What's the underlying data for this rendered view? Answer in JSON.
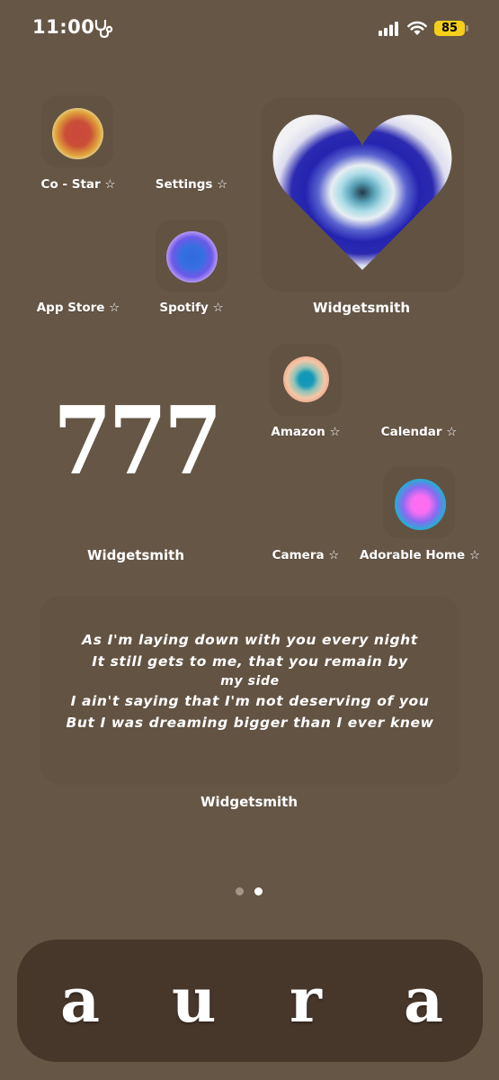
{
  "status_bar": {
    "time": "11:00",
    "focus_icon": "stethoscope-icon",
    "signal_icon": "cellular-signal-icon",
    "wifi_icon": "wifi-icon",
    "battery_level": "85",
    "battery_color": "#f5cf1a"
  },
  "apps": [
    {
      "label": "Co - Star ☆",
      "icon": "orb-red-yellow",
      "colors": [
        "#c9483a",
        "#e0a23a",
        "#eef0c0"
      ]
    },
    {
      "label": "Settings ☆",
      "icon": "blank"
    },
    {
      "label": "App Store ☆",
      "icon": "blank"
    },
    {
      "label": "Spotify ☆",
      "icon": "orb-blue-lilac",
      "colors": [
        "#2f6ae0",
        "#6c5ae8",
        "#f5d6fb"
      ]
    },
    {
      "label": "Amazon ☆",
      "icon": "orb-teal-peach",
      "colors": [
        "#1195b8",
        "#f2c7a6",
        "#e57066"
      ]
    },
    {
      "label": "Calendar ☆",
      "icon": "blank"
    },
    {
      "label": "Camera ☆",
      "icon": "blank"
    },
    {
      "label": "Adorable Home ☆",
      "icon": "orb-pink-teal",
      "colors": [
        "#ff6ef0",
        "#4f6ff0",
        "#22b7a4"
      ]
    }
  ],
  "widgets": {
    "heart": {
      "label": "Widgetsmith",
      "colors": [
        "#1f3a4a",
        "#8fd0e0",
        "#f0f1f3",
        "#2626b0",
        "#eeeef0"
      ]
    },
    "number": {
      "label": "Widgetsmith",
      "text": "777"
    },
    "lyrics": {
      "label": "Widgetsmith",
      "lines": [
        "As I'm laying down with you every night",
        "It still gets to me, that you remain by",
        "my side",
        "I ain't saying that I'm not deserving of you",
        "But I was dreaming bigger than I ever knew"
      ]
    }
  },
  "page_indicator": {
    "pages": 2,
    "current": 2
  },
  "dock": {
    "letters": [
      "a",
      "u",
      "r",
      "a"
    ]
  }
}
